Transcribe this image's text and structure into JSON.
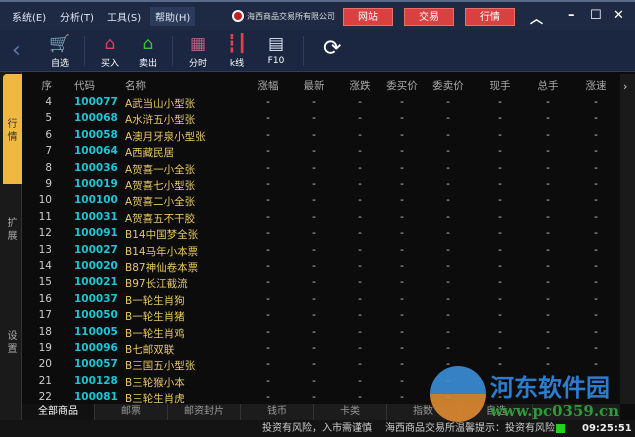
{
  "menu": [
    "系统(E)",
    "分析(T)",
    "工具(S)",
    "帮助(H)"
  ],
  "logo_text": "海西商品交易所有限公司",
  "top_buttons": [
    "网站",
    "交易",
    "行情"
  ],
  "toolbar": [
    "自选",
    "买入",
    "卖出",
    "分时",
    "k线",
    "F10"
  ],
  "side_tabs": [
    "行情",
    "扩展",
    "设置"
  ],
  "columns": [
    "序",
    "代码",
    "名称",
    "涨幅",
    "最新",
    "涨跌",
    "委买价",
    "委卖价",
    "现手",
    "总手",
    "涨速"
  ],
  "rows": [
    [
      "4",
      "100077",
      "A武当山小型张"
    ],
    [
      "5",
      "100068",
      "A水浒五小型张"
    ],
    [
      "6",
      "100058",
      "A澳月牙泉小型张"
    ],
    [
      "7",
      "100064",
      "A西藏民居"
    ],
    [
      "8",
      "100036",
      "A贺喜一小全张"
    ],
    [
      "9",
      "100019",
      "A贺喜七小型张"
    ],
    [
      "10",
      "100100",
      "A贺喜二小全张"
    ],
    [
      "11",
      "100031",
      "A贺喜五不干胶"
    ],
    [
      "12",
      "100091",
      "B14中国梦全张"
    ],
    [
      "13",
      "100027",
      "B14马年小本票"
    ],
    [
      "14",
      "100020",
      "B87神仙卷本票"
    ],
    [
      "15",
      "100021",
      "B97长江截流"
    ],
    [
      "16",
      "100037",
      "B一轮生肖狗"
    ],
    [
      "17",
      "100050",
      "B一轮生肖猪"
    ],
    [
      "18",
      "110005",
      "B一轮生肖鸡"
    ],
    [
      "19",
      "100096",
      "B七邮双联"
    ],
    [
      "20",
      "100057",
      "B三国五小型张"
    ],
    [
      "21",
      "100128",
      "B三轮猴小本"
    ],
    [
      "22",
      "100081",
      "B三轮生肖虎"
    ]
  ],
  "empty_value": "-",
  "bottom_tabs": [
    "全部商品",
    "邮票",
    "邮资封片",
    "钱币",
    "卡类",
    "指数",
    "自选"
  ],
  "status": {
    "ticker": "投资有风险，入市需谨慎",
    "notice": "海西商品交易所温馨提示：投资有风险，",
    "time": "09:25:51"
  },
  "watermark": {
    "name": "河东软件园",
    "url": "www.pc0359.cn"
  }
}
